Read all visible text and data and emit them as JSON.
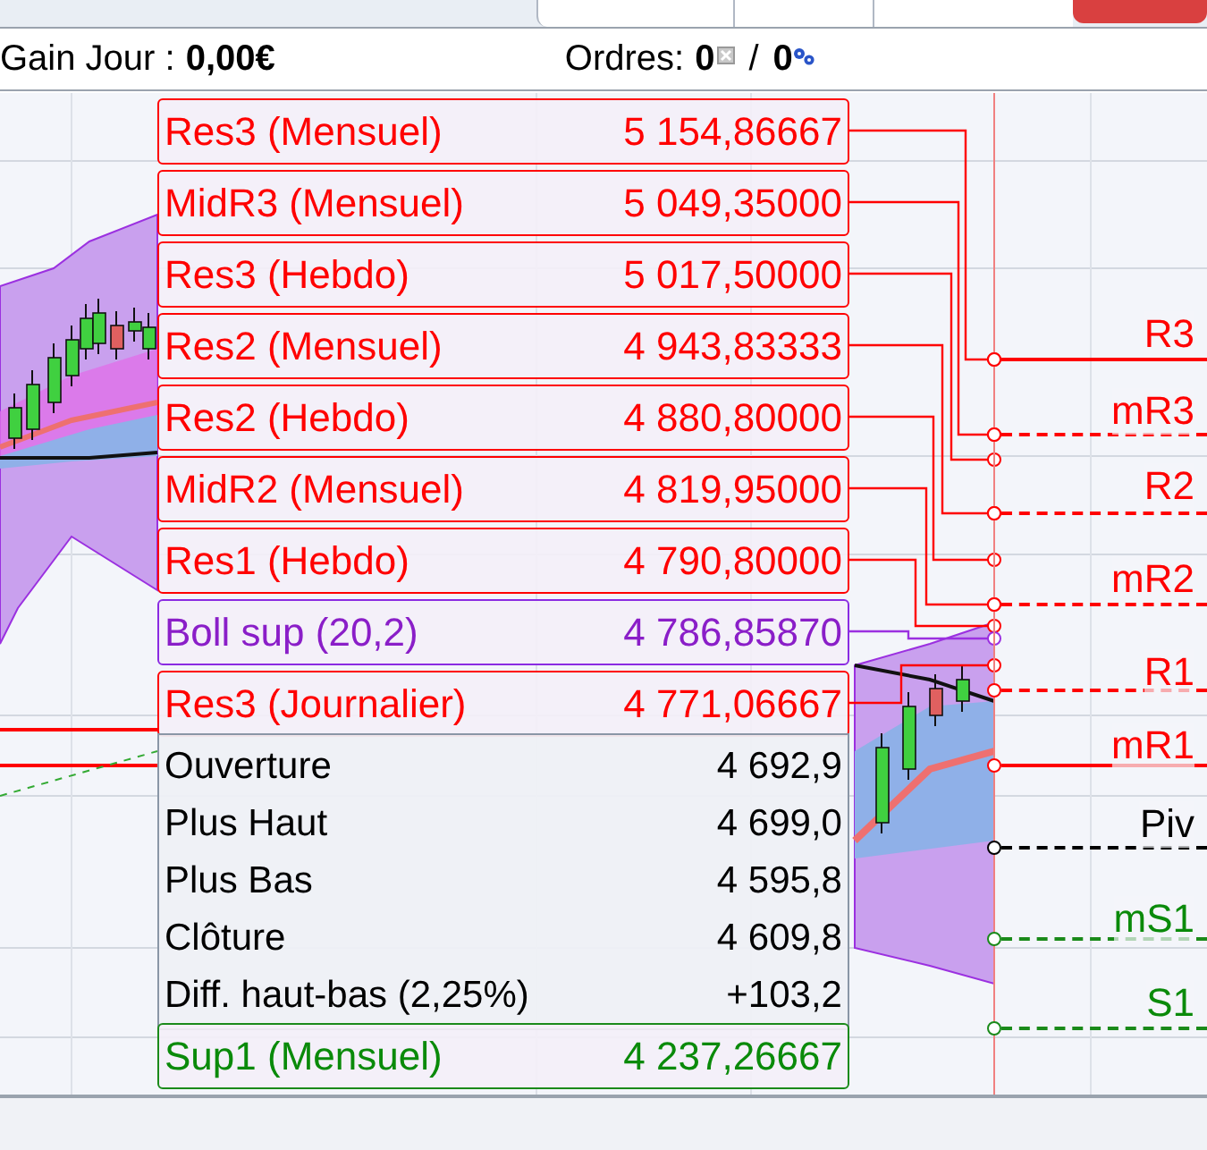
{
  "header": {
    "gain_label": "Gain Jour :",
    "gain_value": "0,00€",
    "orders_label": "Ordres:",
    "orders_open": "0",
    "orders_sep": "/",
    "orders_pending": "0"
  },
  "levels": [
    {
      "label": "Res3 (Mensuel)",
      "value": "5 154,86667",
      "kind": "resistance"
    },
    {
      "label": "MidR3 (Mensuel)",
      "value": "5 049,35000",
      "kind": "resistance"
    },
    {
      "label": "Res3 (Hebdo)",
      "value": "5 017,50000",
      "kind": "resistance"
    },
    {
      "label": "Res2 (Mensuel)",
      "value": "4 943,83333",
      "kind": "resistance"
    },
    {
      "label": "Res2 (Hebdo)",
      "value": "4 880,80000",
      "kind": "resistance"
    },
    {
      "label": "MidR2 (Mensuel)",
      "value": "4 819,95000",
      "kind": "resistance"
    },
    {
      "label": "Res1 (Hebdo)",
      "value": "4 790,80000",
      "kind": "resistance"
    },
    {
      "label": "Boll sup (20,2)",
      "value": "4 786,85870",
      "kind": "bollinger"
    },
    {
      "label": "Res3 (Journalier)",
      "value": "4 771,06667",
      "kind": "resistance"
    }
  ],
  "tooltip": [
    {
      "label": "Ouverture",
      "value": "4 692,9"
    },
    {
      "label": "Plus Haut",
      "value": "4 699,0"
    },
    {
      "label": "Plus Bas",
      "value": "4 595,8"
    },
    {
      "label": "Clôture",
      "value": "4 609,8"
    },
    {
      "label": "Diff. haut-bas (2,25%)",
      "value": "+103,2"
    }
  ],
  "support_levels": [
    {
      "label": "Sup1 (Mensuel)",
      "value": "4 237,26667",
      "kind": "support"
    }
  ],
  "chart_levels": [
    {
      "label": "R3",
      "kind": "resistance",
      "dashed": false
    },
    {
      "label": "mR3",
      "kind": "resistance",
      "dashed": true
    },
    {
      "label": "R2",
      "kind": "resistance",
      "dashed": true
    },
    {
      "label": "mR2",
      "kind": "resistance",
      "dashed": true
    },
    {
      "label": "R1",
      "kind": "resistance",
      "dashed": true
    },
    {
      "label": "mR1",
      "kind": "resistance",
      "dashed": false
    },
    {
      "label": "Piv",
      "kind": "pivot",
      "dashed": true
    },
    {
      "label": "mS1",
      "kind": "support",
      "dashed": true
    },
    {
      "label": "S1",
      "kind": "support",
      "dashed": true
    }
  ]
}
